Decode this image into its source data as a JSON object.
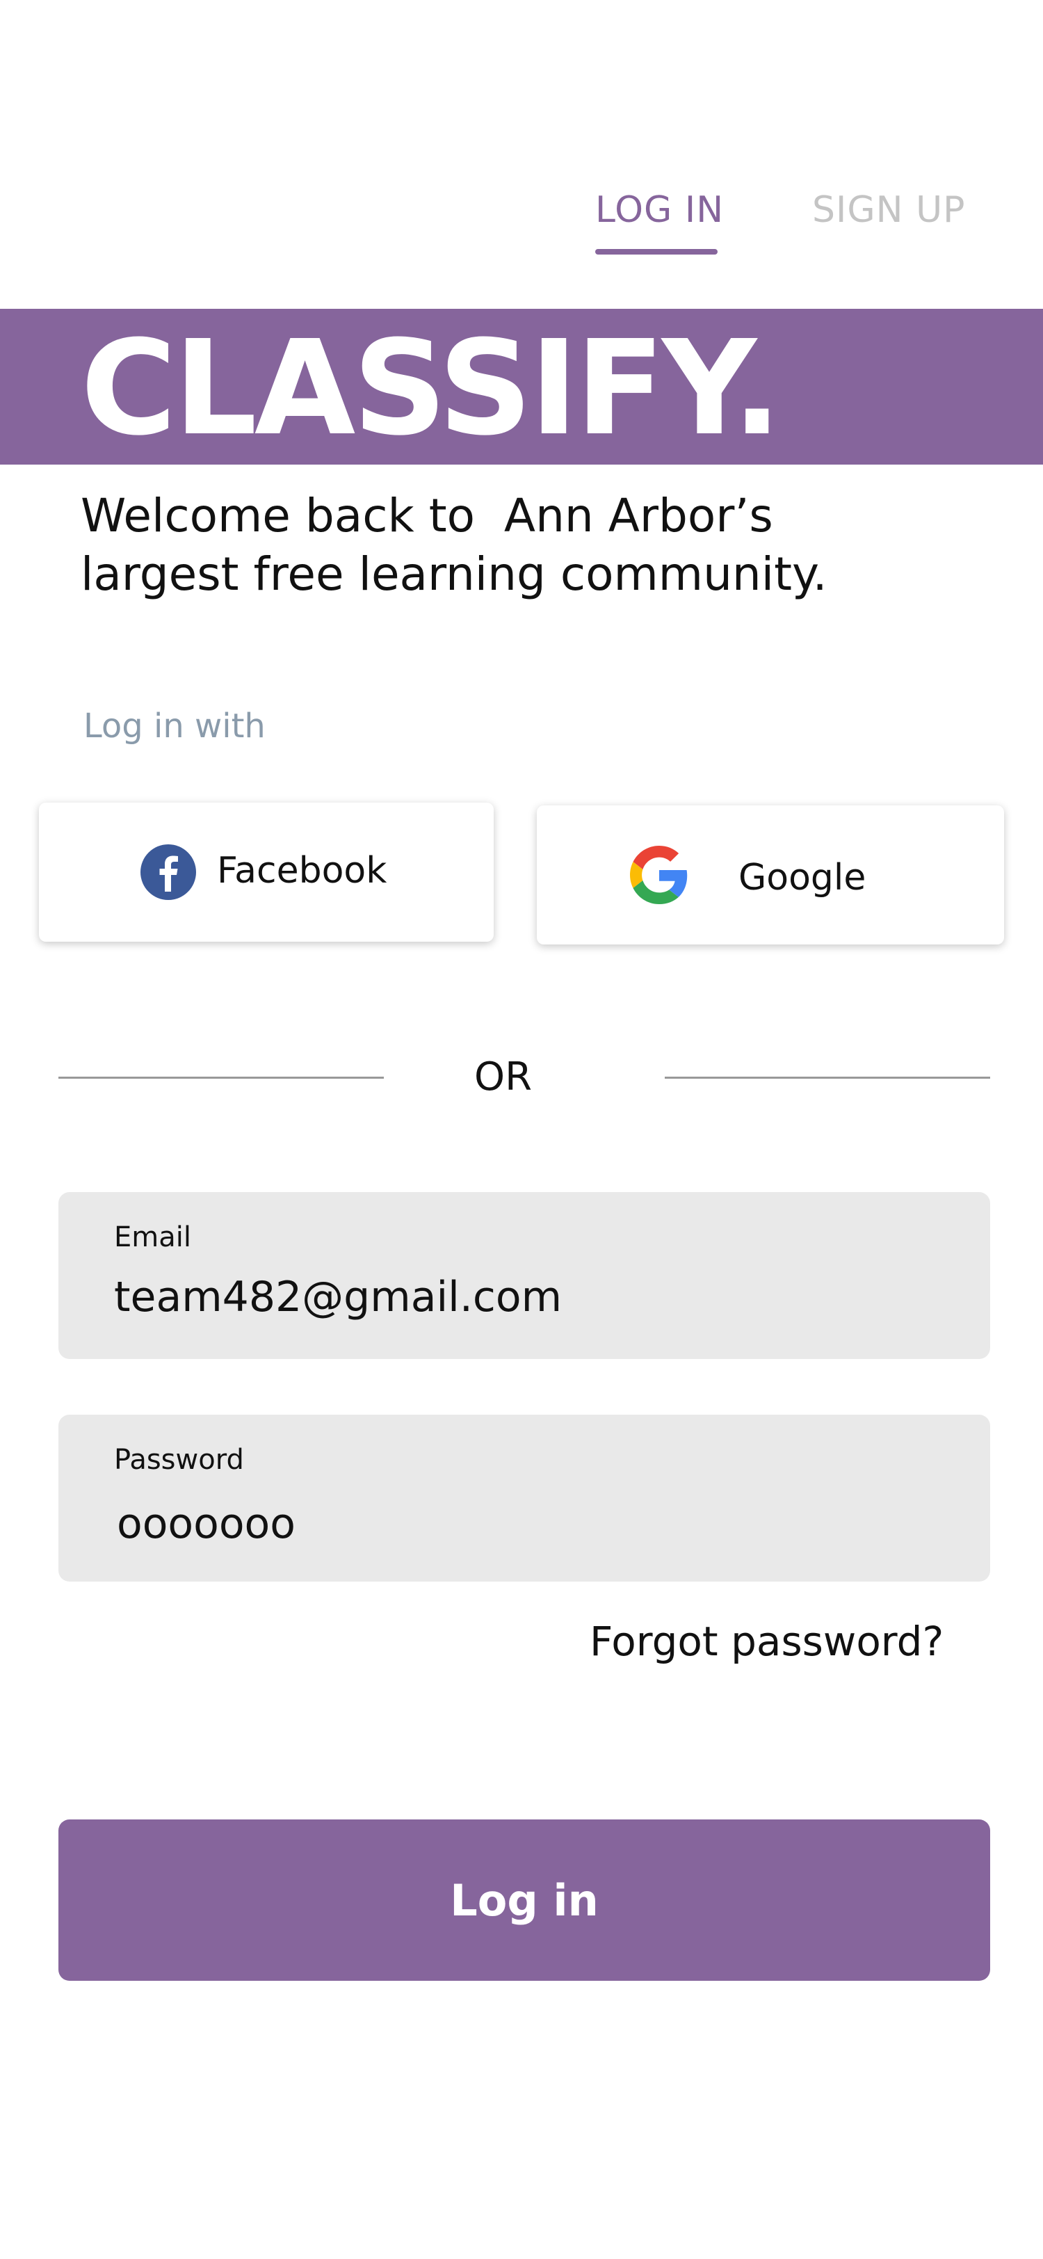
{
  "tabs": {
    "login_label": "LOG IN",
    "signup_label": "SIGN UP",
    "active": "login"
  },
  "brand": {
    "title": "CLASSIFY."
  },
  "welcome": {
    "line1": "Welcome back to  Ann Arbor’s",
    "line2": "largest free learning community."
  },
  "social": {
    "heading": "Log in with",
    "facebook_label": "Facebook",
    "facebook_icon": "facebook-icon",
    "google_label": "Google",
    "google_icon": "google-icon"
  },
  "divider": {
    "label": "OR"
  },
  "form": {
    "email_label": "Email",
    "email_value": "team482@gmail.com",
    "password_label": "Password",
    "password_value": "ooooooo"
  },
  "links": {
    "forgot_password": "Forgot password?"
  },
  "submit": {
    "label": "Log in"
  },
  "colors": {
    "accent": "#86659c",
    "inactive_tab": "#c4c4c4",
    "muted_text": "#8a9bab",
    "field_background": "#e9e9e9",
    "facebook_blue": "#3b5998"
  }
}
